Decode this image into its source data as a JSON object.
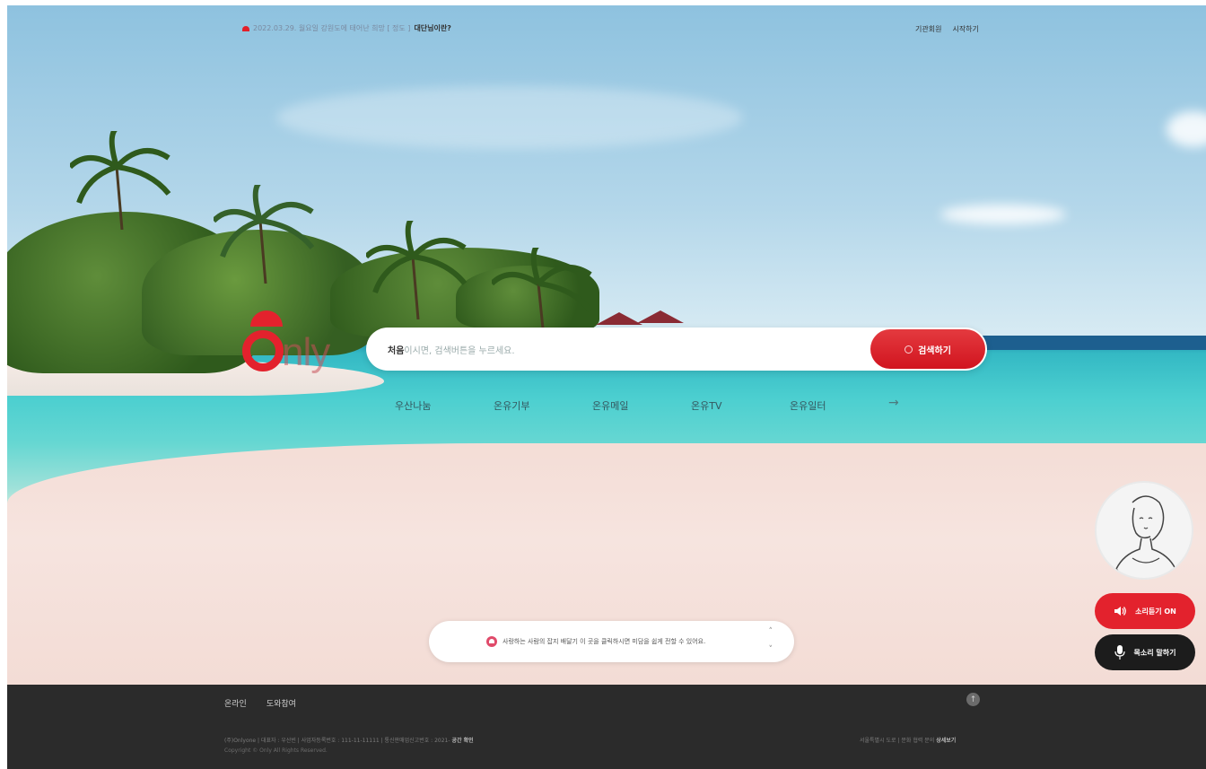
{
  "notice": {
    "text": "2022.03.29. 월요일 강원도에 태어난 희망 [ 정도 ]",
    "link": "대단님이란?"
  },
  "top_links": [
    "기관회원",
    "시작하기"
  ],
  "logo": {
    "text": "nly"
  },
  "search": {
    "placeholder_bold": "처음",
    "placeholder_rest": "이시면, 검색버튼을 누르세요.",
    "button_label": "검색하기"
  },
  "nav": {
    "items": [
      "우산나눔",
      "온유기부",
      "온유메일",
      "온유TV",
      "온유일터"
    ],
    "more": "→"
  },
  "message": {
    "text": "사랑하는 사람의 잡지 배달기 이 곳을 클릭하시면 미담을 쉽게 전할 수 있어요."
  },
  "side": {
    "sound_label": "소리듣기 ON",
    "voice_label": "목소리 말하기"
  },
  "footer": {
    "links": [
      "온라인",
      "도와참여"
    ],
    "info_line": "(주)Onlyone | 대표자 : 우산빈 | 사업자등록번호 : 111-11-11111 | 통신판매업신고번호 : 2021-",
    "info_bold": "공간 확인",
    "copyright": "Copyright © Only All Rights Reserved.",
    "right_text": "서울특별시 도로 | 문화 협력 문의",
    "right_bold": "상세보기",
    "top_icon": "↑"
  },
  "colors": {
    "accent": "#e3222d",
    "dark": "#1c1c1c",
    "footer": "#2b2b2b"
  }
}
